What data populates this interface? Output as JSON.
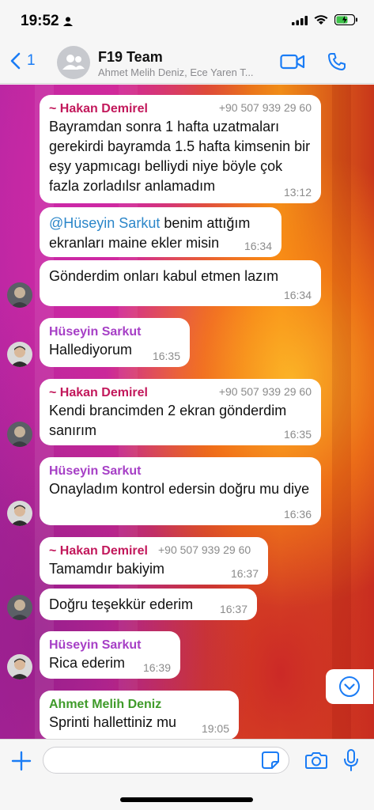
{
  "status_bar": {
    "time": "19:52"
  },
  "header": {
    "back_count": "1",
    "title": "F19 Team",
    "subtitle": "Ahmet Melih Deniz, Ece Yaren T..."
  },
  "messages": [
    {
      "sender": "~ Hakan Demirel",
      "phone": "+90 507 939 29 60",
      "text": "Bayramdan sonra 1 hafta uzatmaları gerekirdi bayramda 1.5 hafta kimsenin bir eşy yapmıcagı belliydi niye böyle çok fazla zorladılsr anlamadım",
      "time": "13:12"
    },
    {
      "mention": "@Hüseyin Sarkut",
      "text": " benim attığım ekranları maine ekler misin",
      "time": "16:34"
    },
    {
      "text": "Gönderdim onları kabul etmen lazım",
      "time": "16:34"
    },
    {
      "sender": "Hüseyin Sarkut",
      "text": "Hallediyorum",
      "time": "16:35"
    },
    {
      "sender": "~ Hakan Demirel",
      "phone": "+90 507 939 29 60",
      "text": "Kendi brancimden 2 ekran gönderdim sanırım",
      "time": "16:35"
    },
    {
      "sender": "Hüseyin Sarkut",
      "text": "Onayladım kontrol edersin doğru mu diye",
      "time": "16:36"
    },
    {
      "sender": "~ Hakan Demirel",
      "phone": "+90 507 939 29 60",
      "text": "Tamamdır bakiyim",
      "time": "16:37"
    },
    {
      "text": "Doğru teşekkür ederim",
      "time": "16:37"
    },
    {
      "sender": "Hüseyin Sarkut",
      "text": "Rica ederim",
      "time": "16:39"
    },
    {
      "sender": "Ahmet Melih Deniz",
      "text": "Sprinti hallettiniz mu",
      "time": "19:05"
    }
  ],
  "colors": {
    "hakan": "#c2185b",
    "huseyin": "#a63fc6",
    "ahmet": "#3f9b2a",
    "accent": "#1a7cf5"
  },
  "icons": [
    "person-icon",
    "signal-icon",
    "wifi-icon",
    "battery-icon",
    "chevron-left-icon",
    "group-icon",
    "video-icon",
    "phone-icon",
    "chevron-down-icon",
    "plus-icon",
    "sticker-icon",
    "camera-icon",
    "mic-icon"
  ],
  "input": {
    "placeholder": ""
  }
}
